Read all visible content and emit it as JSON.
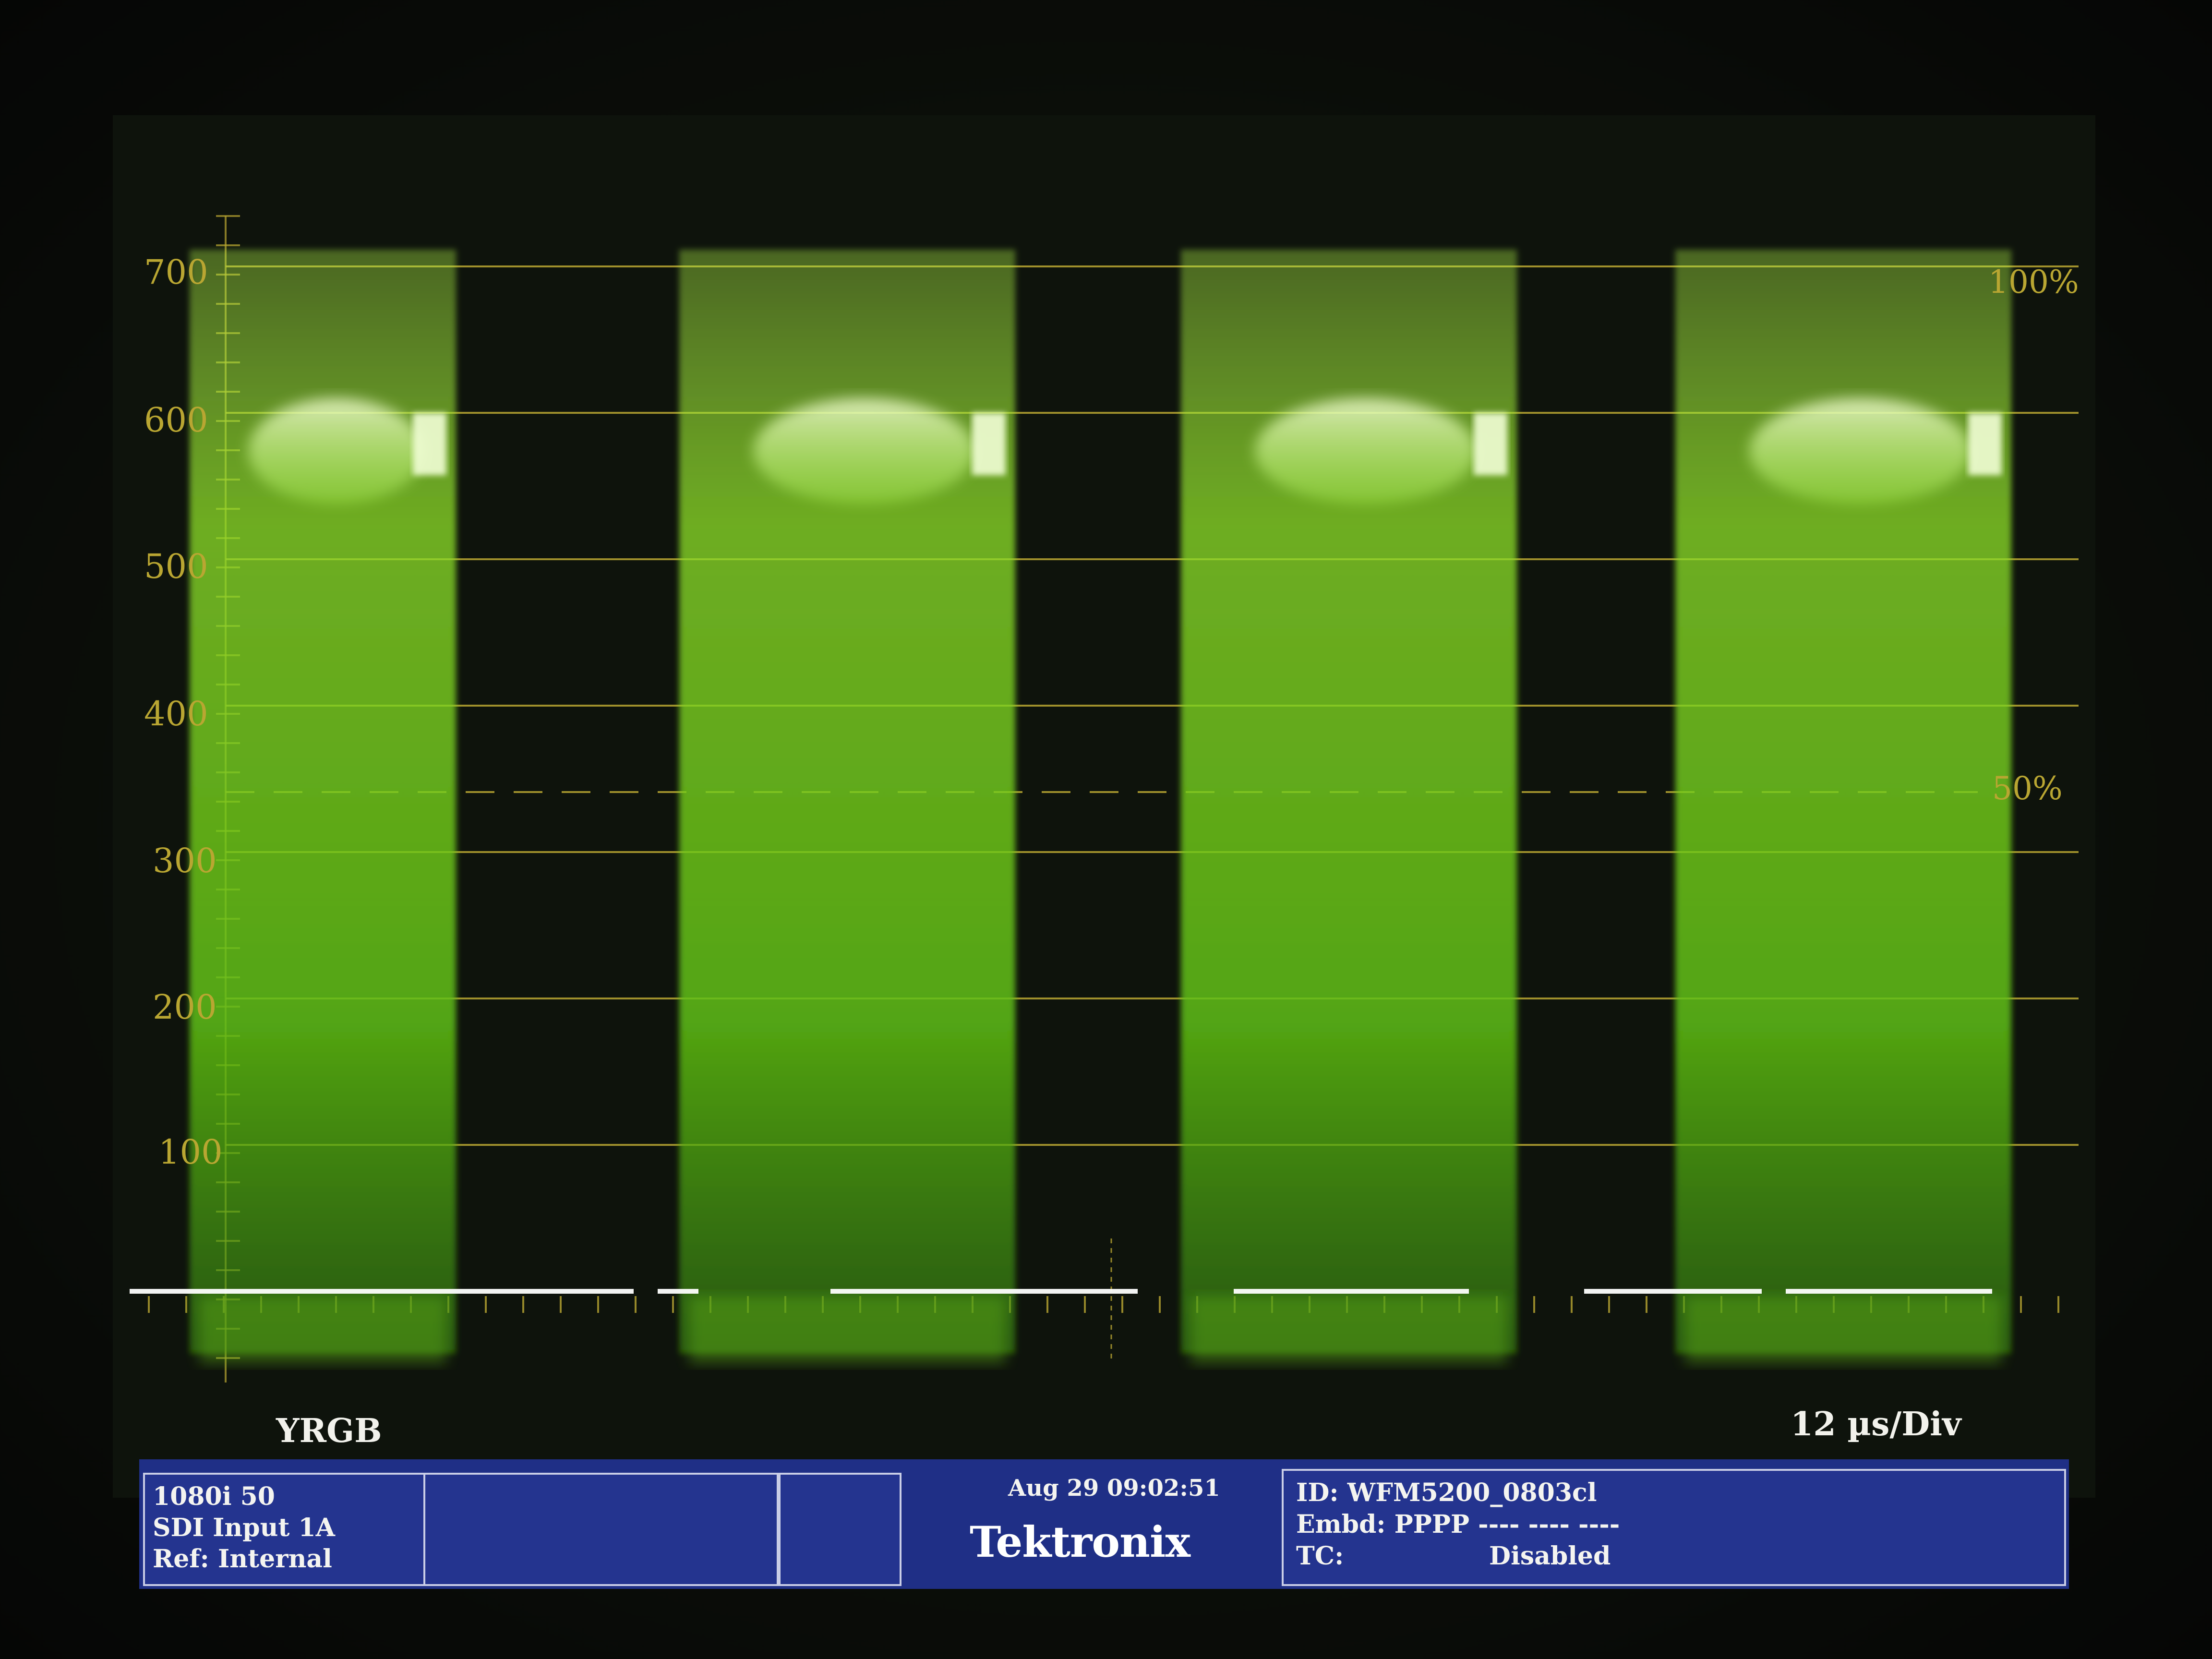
{
  "scale": {
    "mv_labels": [
      "700",
      "600",
      "500",
      "400",
      "300",
      "200",
      "100"
    ],
    "percent_top": "100%",
    "percent_mid": "50%"
  },
  "waveform": {
    "mode": "YRGB",
    "timebase": "12 µs/Div",
    "trace_color": "#7cd61e",
    "graticule_color": "#b9a632"
  },
  "status": {
    "format": "1080i 50",
    "input": "SDI Input 1A",
    "ref": "Ref: Internal",
    "datetime": "Aug 29 09:02:51",
    "brand": "Tektronix",
    "id": "ID: WFM5200_0803cl",
    "embd": "Embd: PPPP ---- ---- ----",
    "tc_label": "TC:",
    "tc_value": "Disabled"
  }
}
